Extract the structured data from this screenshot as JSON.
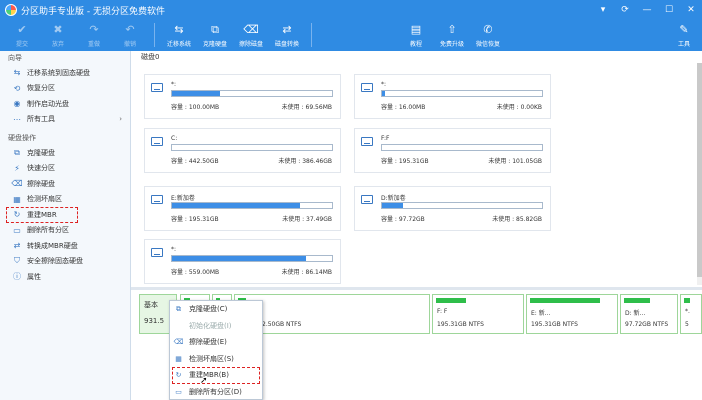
{
  "window": {
    "title": "分区助手专业版 - 无损分区免费软件"
  },
  "toolbar": {
    "left": [
      {
        "icon": "check-icon",
        "label": "提交"
      },
      {
        "icon": "discard-icon",
        "label": "放弃"
      },
      {
        "icon": "redo-icon",
        "label": "重做"
      },
      {
        "icon": "undo-icon",
        "label": "撤销"
      }
    ],
    "middle": [
      {
        "icon": "migrate-icon",
        "label": "迁移系统"
      },
      {
        "icon": "clone-disk-icon",
        "label": "克隆硬盘"
      },
      {
        "icon": "wipe-disk-icon",
        "label": "擦除磁盘"
      },
      {
        "icon": "convert-disk-icon",
        "label": "磁盘转换"
      }
    ],
    "right": [
      {
        "icon": "tutorial-icon",
        "label": "教程"
      },
      {
        "icon": "free-upgrade-icon",
        "label": "免费升级"
      },
      {
        "icon": "wechat-icon",
        "label": "微信恢复"
      }
    ],
    "tools": {
      "icon": "tools-icon",
      "label": "工具"
    }
  },
  "sidebar": {
    "wizard_title": "向导",
    "wizard_items": [
      {
        "icon": "migrate-icon",
        "label": "迁移系统到固态硬盘"
      },
      {
        "icon": "restore-icon",
        "label": "恢复分区"
      },
      {
        "icon": "disc-icon",
        "label": "制作启动光盘"
      },
      {
        "icon": "all-tools-icon",
        "label": "所有工具"
      }
    ],
    "disk_title": "硬盘操作",
    "disk_items": [
      {
        "icon": "clone-disk-icon",
        "label": "克隆硬盘"
      },
      {
        "icon": "quick-partition-icon",
        "label": "快速分区"
      },
      {
        "icon": "wipe-disk-icon",
        "label": "擦除硬盘"
      },
      {
        "icon": "bad-sector-icon",
        "label": "检测坏扇区"
      },
      {
        "icon": "rebuild-mbr-icon",
        "label": "重建MBR"
      },
      {
        "icon": "delete-all-icon",
        "label": "删除所有分区"
      },
      {
        "icon": "convert-mbr-icon",
        "label": "转换成MBR硬盘"
      },
      {
        "icon": "secure-wipe-icon",
        "label": "安全擦除固态硬盘"
      },
      {
        "icon": "properties-icon",
        "label": "属性"
      }
    ]
  },
  "main": {
    "disk_label": "磁盘0",
    "cards": [
      {
        "name": "*:",
        "used_pct": 30,
        "cap_label": "容量 :",
        "cap": "100.00MB",
        "free_label": "未使用 :",
        "free": "69.56MB"
      },
      {
        "name": "*:",
        "used_pct": 2,
        "cap_label": "容量 :",
        "cap": "16.00MB",
        "free_label": "未使用 :",
        "free": "0.00KB"
      },
      {
        "name": "C:",
        "used_pct": 0,
        "cap_label": "容量 :",
        "cap": "442.50GB",
        "free_label": "未使用 :",
        "free": "386.46GB"
      },
      {
        "name": "F:F",
        "used_pct": 0,
        "cap_label": "容量 :",
        "cap": "195.31GB",
        "free_label": "未使用 :",
        "free": "101.05GB"
      },
      {
        "name": "E:新加卷",
        "used_pct": 80,
        "cap_label": "容量 :",
        "cap": "195.31GB",
        "free_label": "未使用 :",
        "free": "37.49GB"
      },
      {
        "name": "D:新加卷",
        "used_pct": 13,
        "cap_label": "容量 :",
        "cap": "97.72GB",
        "free_label": "未使用 :",
        "free": "85.82GB"
      },
      {
        "name": "*:",
        "used_pct": 84,
        "cap_label": "容量 :",
        "cap": "559.00MB",
        "free_label": "未使用 :",
        "free": "86.14MB"
      }
    ]
  },
  "diskmap": {
    "base_line1": "基本",
    "base_line2": "931.5",
    "partitions": [
      {
        "label": "",
        "size": ""
      },
      {
        "label": "",
        "size": ""
      },
      {
        "label": "",
        "size": "2.50GB NTFS"
      },
      {
        "label": "F: F",
        "size": "195.31GB NTFS"
      },
      {
        "label": "E: 新...",
        "size": "195.31GB NTFS"
      },
      {
        "label": "D: 新...",
        "size": "97.72GB NTFS"
      },
      {
        "label": "*.",
        "size": "5"
      }
    ]
  },
  "context_menu": [
    {
      "icon": "clone-disk-icon",
      "label": "克隆硬盘(C)",
      "enabled": true
    },
    {
      "icon": "init-disk-icon",
      "label": "初始化硬盘(I)",
      "enabled": false
    },
    {
      "icon": "wipe-disk-icon",
      "label": "擦除硬盘(E)",
      "enabled": true
    },
    {
      "icon": "bad-sector-icon",
      "label": "检测坏扇区(S)",
      "enabled": true
    },
    {
      "icon": "rebuild-mbr-icon",
      "label": "重建MBR(B)",
      "enabled": true
    },
    {
      "icon": "delete-all-icon",
      "label": "删除所有分区(D)",
      "enabled": true
    }
  ]
}
